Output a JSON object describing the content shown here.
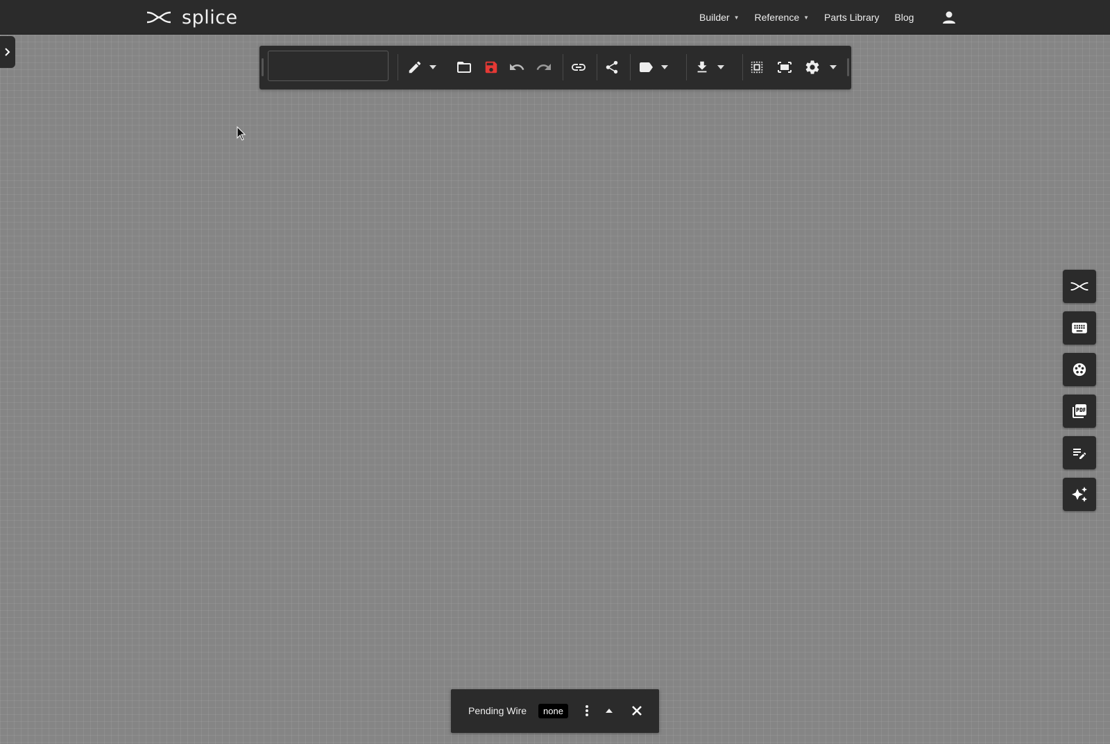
{
  "brand": {
    "name": "splice"
  },
  "nav": {
    "items": [
      {
        "label": "Builder",
        "has_dropdown": true
      },
      {
        "label": "Reference",
        "has_dropdown": true
      },
      {
        "label": "Parts Library",
        "has_dropdown": false
      },
      {
        "label": "Blog",
        "has_dropdown": false
      }
    ],
    "user_icon": "account-icon"
  },
  "toolbar": {
    "name_input": {
      "value": "",
      "placeholder": ""
    },
    "icons": [
      "pencil-icon",
      "folder-open-icon",
      "save-icon",
      "undo-icon",
      "redo-icon",
      "link-icon",
      "share-icon",
      "label-icon",
      "download-icon",
      "select-all-icon",
      "fit-screen-icon",
      "gear-icon"
    ]
  },
  "side_panel": {
    "buttons": [
      "splice-logo-icon",
      "keyboard-icon",
      "parts-icon",
      "pdf-icon",
      "notes-edit-icon",
      "sparkle-icon"
    ]
  },
  "bottom_bar": {
    "label": "Pending Wire",
    "badge": "none"
  },
  "colors": {
    "background": "#858585",
    "panel": "#2b2b2b",
    "save_accent": "#e53935"
  }
}
